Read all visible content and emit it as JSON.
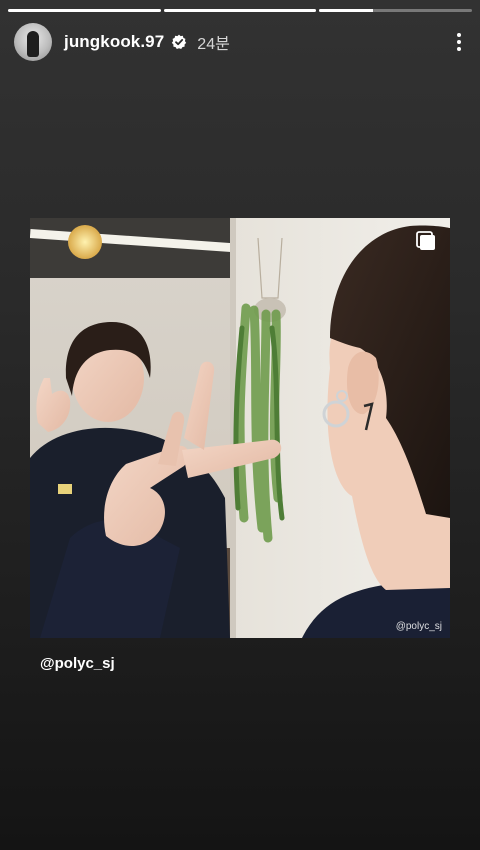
{
  "colors": {
    "background_top": "#323232",
    "background_bottom": "#141414",
    "progress_active": "#ffffff",
    "progress_inactive": "rgba(255,255,255,0.35)",
    "verified_badge": "#ffffff"
  },
  "progress": {
    "segments": [
      1,
      1,
      0.35
    ]
  },
  "header": {
    "username": "jungkook.97",
    "verified": true,
    "time": "24분",
    "avatar_icon": "profile-avatar",
    "more_icon": "more-vertical-icon"
  },
  "post": {
    "carousel_icon": "multiple-images-icon",
    "watermark": "@polyc_sj"
  },
  "mention": {
    "text": "@polyc_sj"
  }
}
